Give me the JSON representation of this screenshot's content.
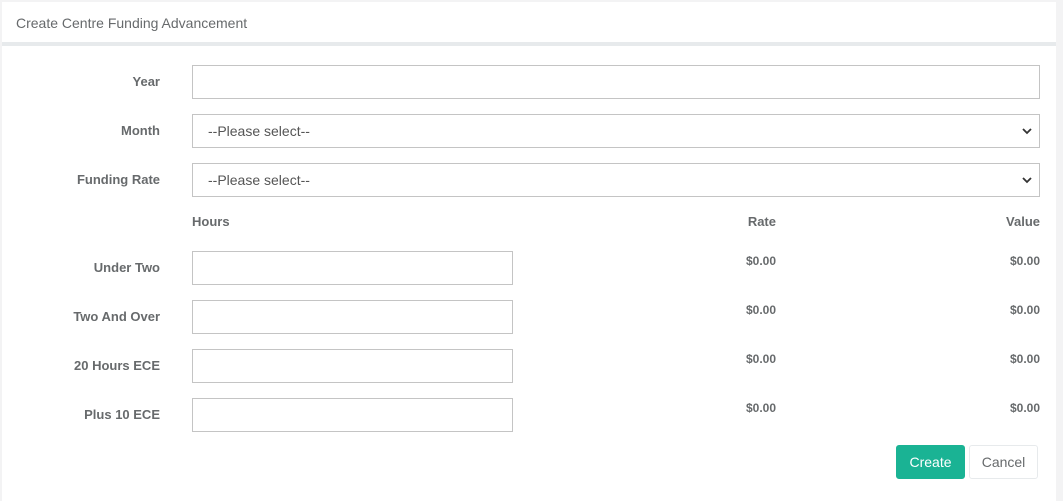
{
  "header": {
    "title": "Create Centre Funding Advancement"
  },
  "form": {
    "year_label": "Year",
    "year_value": "",
    "month_label": "Month",
    "month_selected": "--Please select--",
    "funding_rate_label": "Funding Rate",
    "funding_rate_selected": "--Please select--"
  },
  "table": {
    "headers": {
      "hours": "Hours",
      "rate": "Rate",
      "value": "Value"
    },
    "rows": [
      {
        "label": "Under Two",
        "hours": "",
        "rate": "$0.00",
        "value": "$0.00"
      },
      {
        "label": "Two And Over",
        "hours": "",
        "rate": "$0.00",
        "value": "$0.00"
      },
      {
        "label": "20 Hours ECE",
        "hours": "",
        "rate": "$0.00",
        "value": "$0.00"
      },
      {
        "label": "Plus 10 ECE",
        "hours": "",
        "rate": "$0.00",
        "value": "$0.00"
      }
    ]
  },
  "actions": {
    "create_label": "Create",
    "cancel_label": "Cancel"
  },
  "colors": {
    "primary": "#1ab394",
    "border": "#c4c4c4",
    "text": "#676a6c"
  },
  "icons": {
    "select_arrow": "chevron-down-icon"
  }
}
